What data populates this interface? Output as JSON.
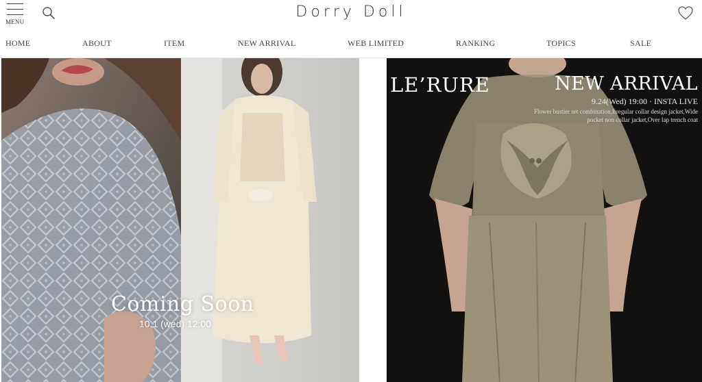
{
  "header": {
    "menu_label": "MENU",
    "logo": "Dorry Doll",
    "icons": [
      "hamburger-icon",
      "search-icon",
      "heart-icon"
    ]
  },
  "nav": [
    {
      "label": "HOME"
    },
    {
      "label": "ABOUT"
    },
    {
      "label": "ITEM"
    },
    {
      "label": "NEW ARRIVAL"
    },
    {
      "label": "WEB LIMITED"
    },
    {
      "label": "RANKING"
    },
    {
      "label": "TOPICS"
    },
    {
      "label": "SALE"
    }
  ],
  "banners": {
    "left": {
      "title": "Coming Soon",
      "date": "10.1 (wed) 12:00"
    },
    "right": {
      "brand": "LE’RURE",
      "title": "NEW ARRIVAL",
      "live": "9.24(Wed) 19:00 · INSTA LIVE",
      "description": "Flower bustier set combination,Irregular collar design jacket,Wide pocket non collar jacket,Over lap trench coat"
    }
  },
  "colors": {
    "text": "#333333",
    "divider": "#e6e6e6",
    "right_banner_bg": "#121110"
  }
}
